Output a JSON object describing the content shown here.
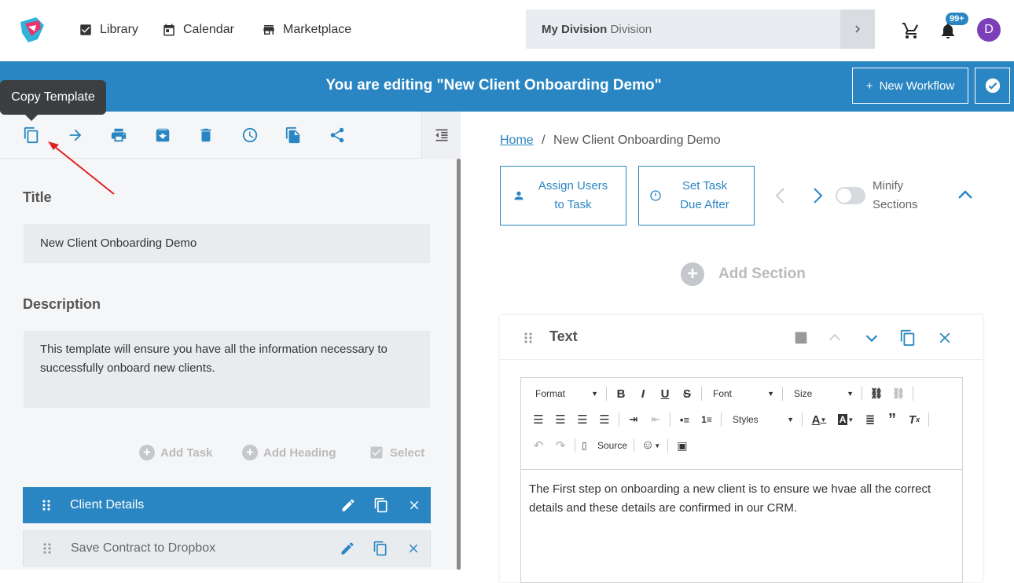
{
  "nav": {
    "library": "Library",
    "calendar": "Calendar",
    "marketplace": "Marketplace",
    "division_bold": "My Division",
    "division_suffix": "Division",
    "notif_badge": "99+",
    "avatar_initial": "D"
  },
  "banner": {
    "title": "You are editing \"New Client Onboarding Demo\"",
    "new_workflow": "New Workflow"
  },
  "tooltip": "Copy Template",
  "left_panel": {
    "title_label": "Title",
    "title_value": "New Client Onboarding Demo",
    "description_label": "Description",
    "description_value": "This template will ensure you have all the information necessary to successfully onboard new clients.",
    "add_task": "Add Task",
    "add_heading": "Add Heading",
    "select": "Select",
    "tasks": [
      {
        "name": "Client Details",
        "active": true
      },
      {
        "name": "Save Contract to Dropbox",
        "active": false
      }
    ]
  },
  "right_panel": {
    "breadcrumb_home": "Home",
    "breadcrumb_sep": "/",
    "breadcrumb_current": "New Client Onboarding Demo",
    "assign_users_line1": "Assign Users",
    "assign_users_line2": "to Task",
    "set_due_line1": "Set Task",
    "set_due_line2": "Due After",
    "minify_line1": "Minify",
    "minify_line2": "Sections",
    "add_section": "Add Section",
    "card_title": "Text",
    "editor": {
      "format": "Format",
      "font": "Font",
      "size": "Size",
      "styles": "Styles",
      "source": "Source",
      "content": "The First step on onboarding a new client is to ensure we hvae all the correct details and these details are confirmed in our CRM."
    }
  },
  "colors": {
    "primary": "#2a86c2",
    "avatar": "#7b3fb8",
    "annotation_arrow": "#e0201f"
  }
}
